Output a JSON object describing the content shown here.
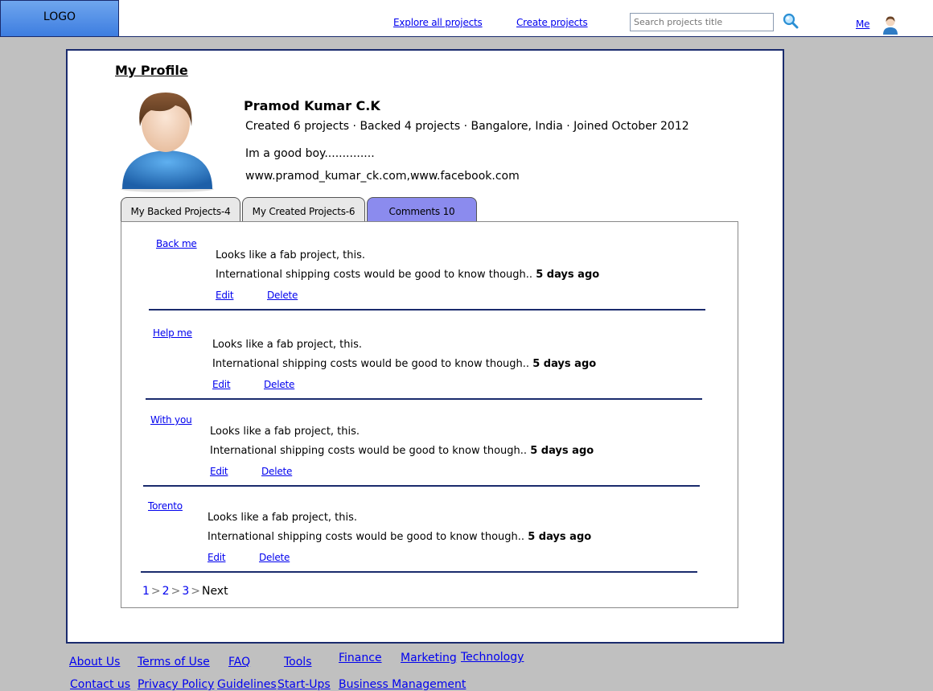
{
  "header": {
    "logo": "LOGO",
    "nav": [
      "Explore all projects",
      "Create projects"
    ],
    "search_placeholder": "Search projects title",
    "me": "Me"
  },
  "profile": {
    "title": "My Profile",
    "name": "Pramod Kumar C.K",
    "stats": "Created 6 projects · Backed 4 projects · Bangalore, India · Joined October 2012",
    "bio": "Im a good boy..............",
    "links": "www.pramod_kumar_ck.com,www.facebook.com"
  },
  "tabs": [
    {
      "label": "My Backed Projects-4"
    },
    {
      "label": "My Created Projects-6"
    },
    {
      "label": "Comments 10",
      "active": true
    }
  ],
  "comments": [
    {
      "project": "Back me",
      "line1": "Looks like a fab project, this.",
      "line2": "International shipping costs would be good to know though..",
      "time": "5 days ago",
      "edit": "Edit",
      "delete": "Delete"
    },
    {
      "project": "Help me",
      "line1": "Looks like a fab project, this.",
      "line2": "International shipping costs would be good to know though..",
      "time": "5 days ago",
      "edit": "Edit",
      "delete": "Delete"
    },
    {
      "project": "With you",
      "line1": "Looks like a fab project, this.",
      "line2": "International shipping costs would be good to know though..",
      "time": "5 days ago",
      "edit": "Edit",
      "delete": "Delete"
    },
    {
      "project": "Torento",
      "line1": "Looks like a fab project, this.",
      "line2": "International shipping costs would be good to know though..",
      "time": "5 days ago",
      "edit": "Edit",
      "delete": "Delete"
    }
  ],
  "pagination": {
    "pages": [
      "1",
      "2",
      "3"
    ],
    "next": "Next"
  },
  "footer": {
    "about": "About Us",
    "terms": "Terms of Use",
    "faq": "FAQ",
    "tools": "Tools",
    "finance": "Finance",
    "marketing": "Marketing",
    "technology": "Technology",
    "contact": "Contact us",
    "privacy": "Privacy Policy",
    "guidelines": "Guidelines",
    "startups": "Start-Ups",
    "business": "Business Management"
  },
  "colors": {
    "accent": "#1a2b6d",
    "active_tab": "#8b8bee",
    "link": "#0000ee",
    "background": "#c0c0c0"
  }
}
